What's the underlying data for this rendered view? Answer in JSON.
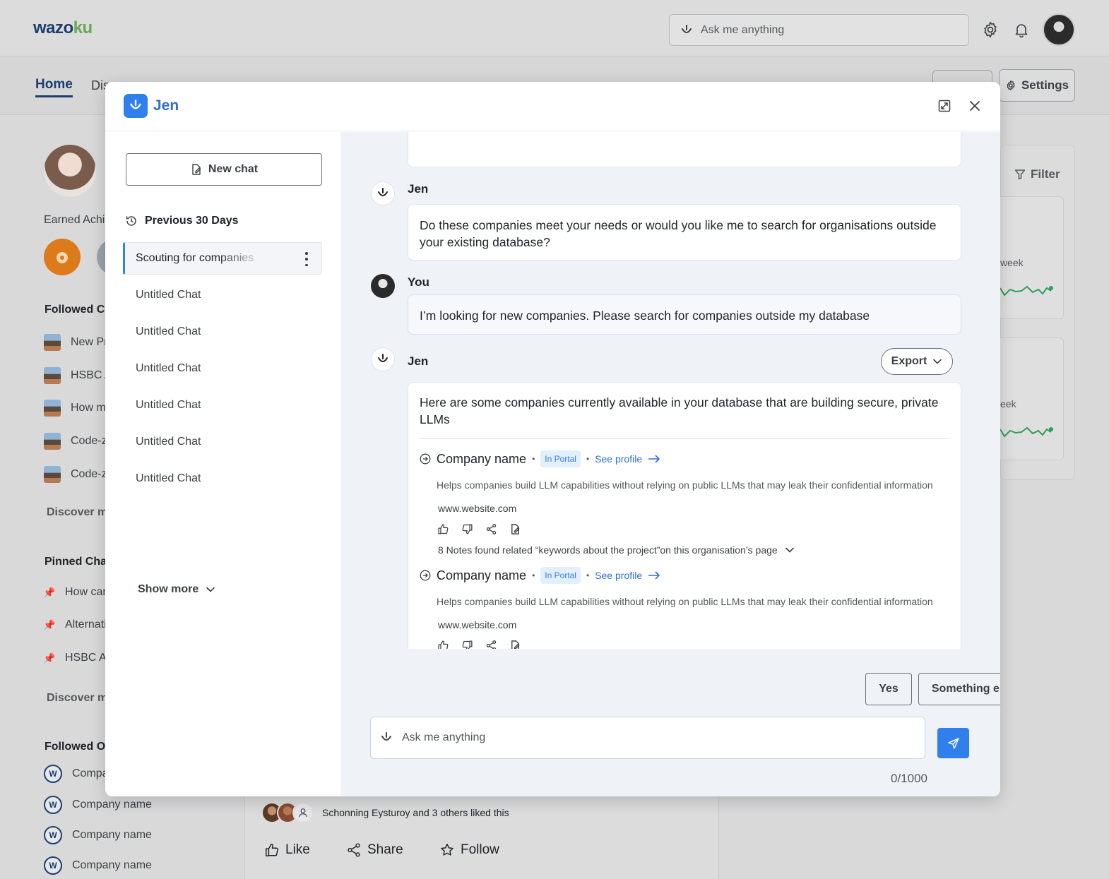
{
  "app": {
    "logo_prefix": "wazo",
    "logo_suffix": "ku",
    "search_placeholder": "Ask me anything"
  },
  "nav": {
    "home": "Home",
    "discover_partial": "Dis",
    "settings": "Settings"
  },
  "profile": {
    "earned": "Earned Achi"
  },
  "left_sections": {
    "followed_challenges": "Followed Cl",
    "followed_items": [
      "New Pr",
      "HSBC A",
      "How m",
      "Code-z",
      "Code-z"
    ],
    "discover_more_1": "Discover m",
    "pinned": "Pinned Cha",
    "pinned_items": [
      "How can",
      "Alternati",
      "HSBC As"
    ],
    "discover_more_2": "Discover m",
    "followed_orgs": "Followed O",
    "org_items": [
      "Compa",
      "Company name",
      "Company name",
      "Company name"
    ]
  },
  "right_panel": {
    "filter": "Filter",
    "week_1": "week",
    "week_2": "eek",
    "spark_color": "#2e9e5a"
  },
  "feed": {
    "liked_text": "Schonning Eysturoy and 3 others liked this",
    "like": "Like",
    "share": "Share",
    "follow": "Follow"
  },
  "modal": {
    "title": "Jen",
    "new_chat": "New chat",
    "previous_label": "Previous 30 Days",
    "active_chat": "Scouting for companies",
    "chats": [
      "Untitled Chat",
      "Untitled Chat",
      "Untitled Chat",
      "Untitled Chat",
      "Untitled Chat",
      "Untitled Chat"
    ],
    "show_more": "Show more",
    "messages": {
      "bot_name": "Jen",
      "user_name": "You",
      "bot_question": "Do these companies meet your needs or would you like me to search for organisations outside your existing database?",
      "user_reply": "I’m looking for new companies. Please search for companies outside my database",
      "export": "Export",
      "results_intro": "Here are some companies currently available in your database that are building secure, private LLMs",
      "companies": [
        {
          "name": "Company name",
          "badge": "In Portal",
          "see_profile": "See profile",
          "desc": "Helps companies build LLM capabilities without relying on public LLMs that may leak their confidential information",
          "website": "www.website.com",
          "notes": "8 Notes found related “keywords about the project”on this organisation’s page"
        },
        {
          "name": "Company name",
          "badge": "In Portal",
          "see_profile": "See profile",
          "desc": "Helps companies build LLM capabilities without relying on public LLMs that may leak their confidential information",
          "website": "www.website.com"
        }
      ]
    },
    "quick_replies": [
      "Yes",
      "Something else"
    ],
    "input_placeholder": "Ask me anything",
    "counter": "0/1000",
    "accent": "#2f80ed"
  }
}
